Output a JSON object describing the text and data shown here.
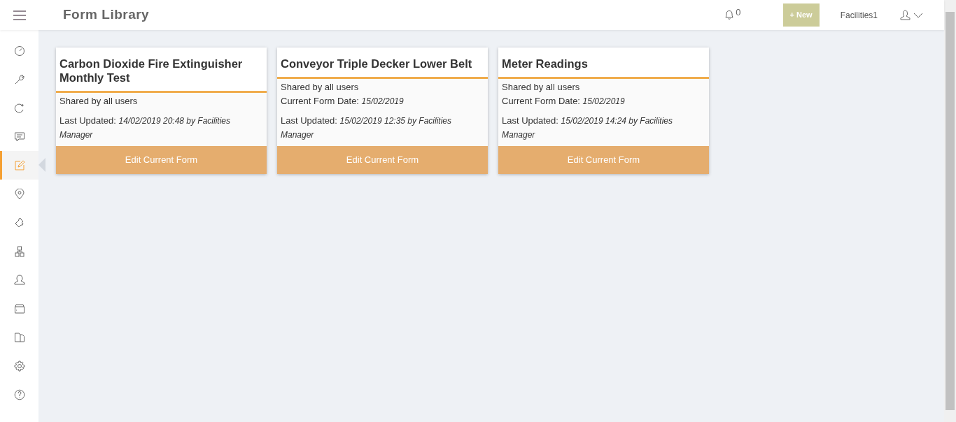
{
  "topbar": {
    "title": "Form Library",
    "notification_count": "0",
    "new_button": "+ New",
    "user_name": "Facilities1"
  },
  "sidebar": {
    "items": [
      {
        "selected": false
      },
      {
        "selected": false
      },
      {
        "selected": false
      },
      {
        "selected": false
      },
      {
        "selected": true
      },
      {
        "selected": false
      },
      {
        "selected": false
      },
      {
        "selected": false
      },
      {
        "selected": false
      },
      {
        "selected": false
      },
      {
        "selected": false
      },
      {
        "selected": false
      },
      {
        "selected": false
      }
    ]
  },
  "forms": [
    {
      "title": "Carbon Dioxide Fire Extinguisher Monthly Test",
      "sharing": "Shared by all users",
      "details": [
        {
          "label": "Last Updated:",
          "value": "14/02/2019 20:48 by Facilities Manager"
        }
      ],
      "button": "Edit Current Form"
    },
    {
      "title": "Conveyor Triple Decker Lower Belt",
      "sharing": "Shared by all users",
      "details": [
        {
          "label": "Current Form Date:",
          "value": "15/02/2019"
        },
        {
          "label": "Last Updated:",
          "value": "15/02/2019 12:35 by Facilities Manager"
        }
      ],
      "button": "Edit Current Form"
    },
    {
      "title": "Meter Readings",
      "sharing": "Shared by all users",
      "details": [
        {
          "label": "Current Form Date:",
          "value": "15/02/2019"
        },
        {
          "label": "Last Updated:",
          "value": "15/02/2019 14:24 by Facilities Manager"
        }
      ],
      "button": "Edit Current Form"
    }
  ]
}
